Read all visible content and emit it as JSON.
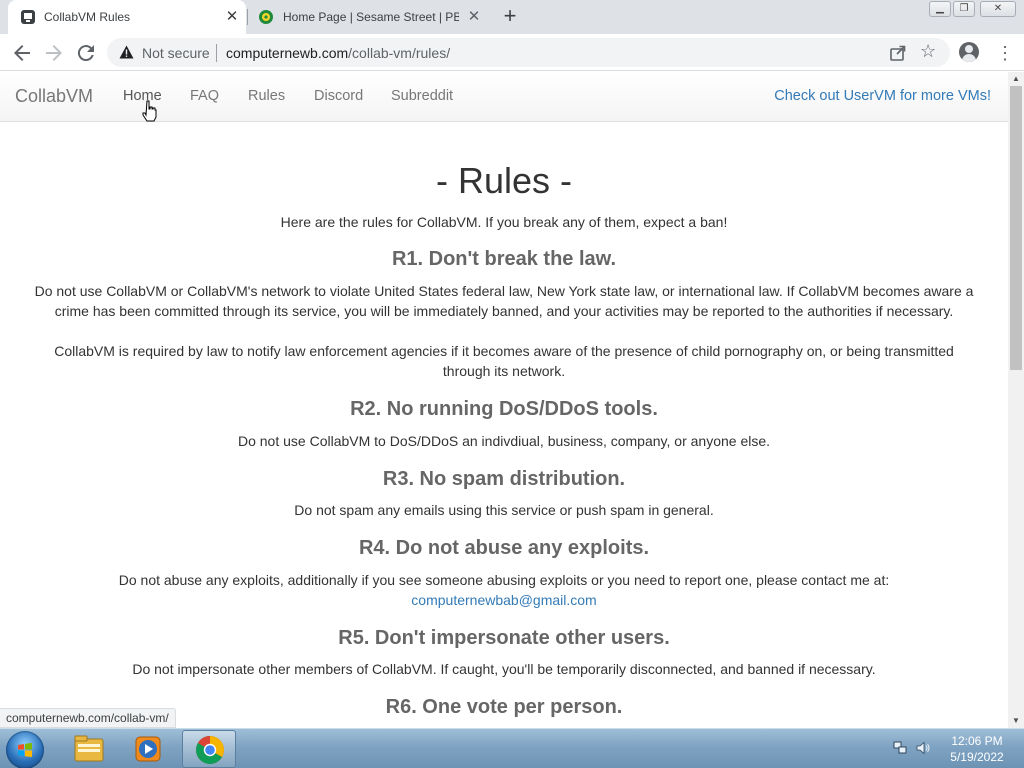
{
  "browser": {
    "tabs": [
      {
        "title": "CollabVM Rules",
        "active": true
      },
      {
        "title": "Home Page | Sesame Street | PBS",
        "active": false
      }
    ],
    "security_label": "Not secure",
    "url_host": "computernewb.com",
    "url_path": "/collab-vm/rules/",
    "status_url": "computernewb.com/collab-vm/"
  },
  "site": {
    "brand": "CollabVM",
    "nav": [
      "Home",
      "FAQ",
      "Rules",
      "Discord",
      "Subreddit"
    ],
    "promo_link": "Check out UserVM for more VMs!"
  },
  "page": {
    "heading": "- Rules -",
    "intro": "Here are the rules for CollabVM. If you break any of them, expect a ban!",
    "rules": [
      {
        "title": "R1. Don't break the law.",
        "paragraphs": [
          "Do not use CollabVM or CollabVM's network to violate United States federal law, New York state law, or international law. If CollabVM becomes aware a crime has been committed through its service, you will be immediately banned, and your activities may be reported to the authorities if necessary.",
          "CollabVM is required by law to notify law enforcement agencies if it becomes aware of the presence of child pornography on, or being transmitted through its network."
        ]
      },
      {
        "title": "R2. No running DoS/DDoS tools.",
        "paragraphs": [
          "Do not use CollabVM to DoS/DDoS an indivdiual, business, company, or anyone else."
        ]
      },
      {
        "title": "R3. No spam distribution.",
        "paragraphs": [
          "Do not spam any emails using this service or push spam in general."
        ]
      },
      {
        "title": "R4. Do not abuse any exploits.",
        "paragraphs": [
          "Do not abuse any exploits, additionally if you see someone abusing exploits or you need to report one, please contact me at:"
        ],
        "email": "computernewbab@gmail.com"
      },
      {
        "title": "R5. Don't impersonate other users.",
        "paragraphs": [
          "Do not impersonate other members of CollabVM. If caught, you'll be temporarily disconnected, and banned if necessary."
        ]
      },
      {
        "title": "R6. One vote per person.",
        "paragraphs": []
      }
    ]
  },
  "taskbar": {
    "pinned": [
      "windows-explorer",
      "windows-media-player",
      "google-chrome"
    ],
    "time": "12:06 PM",
    "date": "5/19/2022"
  }
}
